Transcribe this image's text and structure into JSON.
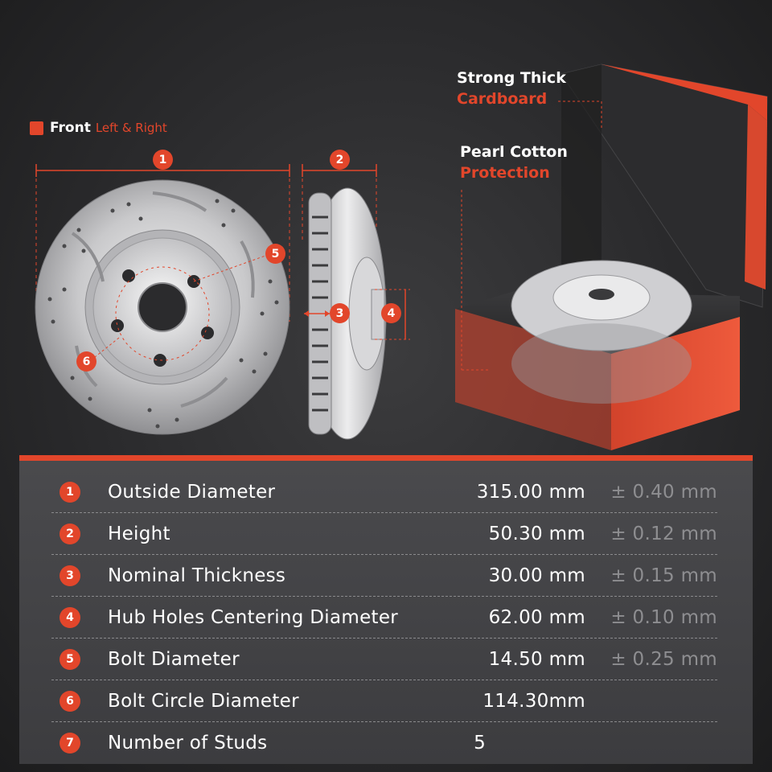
{
  "front": {
    "title": "Front",
    "subtitle": "Left & Right"
  },
  "callouts": {
    "cardboard": {
      "line1": "Strong Thick",
      "line2": "Cardboard"
    },
    "cotton": {
      "line1": "Pearl Cotton",
      "line2": "Protection"
    }
  },
  "dimension_badges": [
    "1",
    "2",
    "3",
    "4",
    "5",
    "6"
  ],
  "specs": [
    {
      "index": "1",
      "name": "Outside Diameter",
      "value": "315.00 mm",
      "tolerance": "± 0.40 mm"
    },
    {
      "index": "2",
      "name": "Height",
      "value": "50.30 mm",
      "tolerance": "± 0.12 mm"
    },
    {
      "index": "3",
      "name": "Nominal Thickness",
      "value": "30.00 mm",
      "tolerance": "± 0.15 mm"
    },
    {
      "index": "4",
      "name": "Hub Holes Centering Diameter",
      "value": "62.00 mm",
      "tolerance": "± 0.10 mm"
    },
    {
      "index": "5",
      "name": "Bolt Diameter",
      "value": "14.50 mm",
      "tolerance": "± 0.25 mm"
    },
    {
      "index": "6",
      "name": "Bolt Circle Diameter",
      "value": "114.30mm",
      "tolerance": ""
    },
    {
      "index": "7",
      "name": "Number of Studs",
      "value": "5",
      "tolerance": ""
    }
  ],
  "colors": {
    "accent": "#e2462b",
    "background": "#2a2a2c",
    "panel": "#454548",
    "tolerance_text": "#8e8e91"
  }
}
